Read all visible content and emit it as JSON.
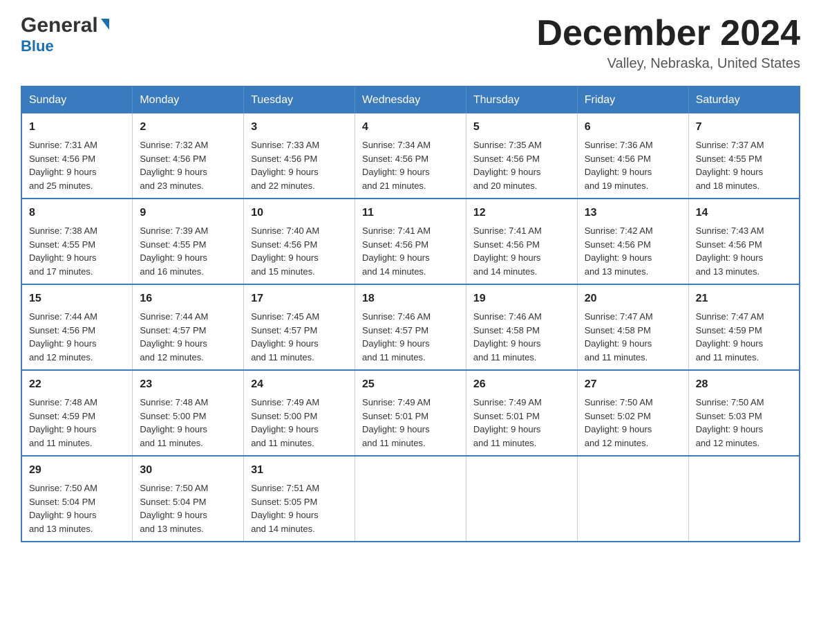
{
  "header": {
    "logo_general": "General",
    "logo_blue": "Blue",
    "month_title": "December 2024",
    "location": "Valley, Nebraska, United States"
  },
  "days_of_week": [
    "Sunday",
    "Monday",
    "Tuesday",
    "Wednesday",
    "Thursday",
    "Friday",
    "Saturday"
  ],
  "weeks": [
    [
      {
        "day": "1",
        "sunrise": "Sunrise: 7:31 AM",
        "sunset": "Sunset: 4:56 PM",
        "daylight": "Daylight: 9 hours",
        "daylight2": "and 25 minutes."
      },
      {
        "day": "2",
        "sunrise": "Sunrise: 7:32 AM",
        "sunset": "Sunset: 4:56 PM",
        "daylight": "Daylight: 9 hours",
        "daylight2": "and 23 minutes."
      },
      {
        "day": "3",
        "sunrise": "Sunrise: 7:33 AM",
        "sunset": "Sunset: 4:56 PM",
        "daylight": "Daylight: 9 hours",
        "daylight2": "and 22 minutes."
      },
      {
        "day": "4",
        "sunrise": "Sunrise: 7:34 AM",
        "sunset": "Sunset: 4:56 PM",
        "daylight": "Daylight: 9 hours",
        "daylight2": "and 21 minutes."
      },
      {
        "day": "5",
        "sunrise": "Sunrise: 7:35 AM",
        "sunset": "Sunset: 4:56 PM",
        "daylight": "Daylight: 9 hours",
        "daylight2": "and 20 minutes."
      },
      {
        "day": "6",
        "sunrise": "Sunrise: 7:36 AM",
        "sunset": "Sunset: 4:56 PM",
        "daylight": "Daylight: 9 hours",
        "daylight2": "and 19 minutes."
      },
      {
        "day": "7",
        "sunrise": "Sunrise: 7:37 AM",
        "sunset": "Sunset: 4:55 PM",
        "daylight": "Daylight: 9 hours",
        "daylight2": "and 18 minutes."
      }
    ],
    [
      {
        "day": "8",
        "sunrise": "Sunrise: 7:38 AM",
        "sunset": "Sunset: 4:55 PM",
        "daylight": "Daylight: 9 hours",
        "daylight2": "and 17 minutes."
      },
      {
        "day": "9",
        "sunrise": "Sunrise: 7:39 AM",
        "sunset": "Sunset: 4:55 PM",
        "daylight": "Daylight: 9 hours",
        "daylight2": "and 16 minutes."
      },
      {
        "day": "10",
        "sunrise": "Sunrise: 7:40 AM",
        "sunset": "Sunset: 4:56 PM",
        "daylight": "Daylight: 9 hours",
        "daylight2": "and 15 minutes."
      },
      {
        "day": "11",
        "sunrise": "Sunrise: 7:41 AM",
        "sunset": "Sunset: 4:56 PM",
        "daylight": "Daylight: 9 hours",
        "daylight2": "and 14 minutes."
      },
      {
        "day": "12",
        "sunrise": "Sunrise: 7:41 AM",
        "sunset": "Sunset: 4:56 PM",
        "daylight": "Daylight: 9 hours",
        "daylight2": "and 14 minutes."
      },
      {
        "day": "13",
        "sunrise": "Sunrise: 7:42 AM",
        "sunset": "Sunset: 4:56 PM",
        "daylight": "Daylight: 9 hours",
        "daylight2": "and 13 minutes."
      },
      {
        "day": "14",
        "sunrise": "Sunrise: 7:43 AM",
        "sunset": "Sunset: 4:56 PM",
        "daylight": "Daylight: 9 hours",
        "daylight2": "and 13 minutes."
      }
    ],
    [
      {
        "day": "15",
        "sunrise": "Sunrise: 7:44 AM",
        "sunset": "Sunset: 4:56 PM",
        "daylight": "Daylight: 9 hours",
        "daylight2": "and 12 minutes."
      },
      {
        "day": "16",
        "sunrise": "Sunrise: 7:44 AM",
        "sunset": "Sunset: 4:57 PM",
        "daylight": "Daylight: 9 hours",
        "daylight2": "and 12 minutes."
      },
      {
        "day": "17",
        "sunrise": "Sunrise: 7:45 AM",
        "sunset": "Sunset: 4:57 PM",
        "daylight": "Daylight: 9 hours",
        "daylight2": "and 11 minutes."
      },
      {
        "day": "18",
        "sunrise": "Sunrise: 7:46 AM",
        "sunset": "Sunset: 4:57 PM",
        "daylight": "Daylight: 9 hours",
        "daylight2": "and 11 minutes."
      },
      {
        "day": "19",
        "sunrise": "Sunrise: 7:46 AM",
        "sunset": "Sunset: 4:58 PM",
        "daylight": "Daylight: 9 hours",
        "daylight2": "and 11 minutes."
      },
      {
        "day": "20",
        "sunrise": "Sunrise: 7:47 AM",
        "sunset": "Sunset: 4:58 PM",
        "daylight": "Daylight: 9 hours",
        "daylight2": "and 11 minutes."
      },
      {
        "day": "21",
        "sunrise": "Sunrise: 7:47 AM",
        "sunset": "Sunset: 4:59 PM",
        "daylight": "Daylight: 9 hours",
        "daylight2": "and 11 minutes."
      }
    ],
    [
      {
        "day": "22",
        "sunrise": "Sunrise: 7:48 AM",
        "sunset": "Sunset: 4:59 PM",
        "daylight": "Daylight: 9 hours",
        "daylight2": "and 11 minutes."
      },
      {
        "day": "23",
        "sunrise": "Sunrise: 7:48 AM",
        "sunset": "Sunset: 5:00 PM",
        "daylight": "Daylight: 9 hours",
        "daylight2": "and 11 minutes."
      },
      {
        "day": "24",
        "sunrise": "Sunrise: 7:49 AM",
        "sunset": "Sunset: 5:00 PM",
        "daylight": "Daylight: 9 hours",
        "daylight2": "and 11 minutes."
      },
      {
        "day": "25",
        "sunrise": "Sunrise: 7:49 AM",
        "sunset": "Sunset: 5:01 PM",
        "daylight": "Daylight: 9 hours",
        "daylight2": "and 11 minutes."
      },
      {
        "day": "26",
        "sunrise": "Sunrise: 7:49 AM",
        "sunset": "Sunset: 5:01 PM",
        "daylight": "Daylight: 9 hours",
        "daylight2": "and 11 minutes."
      },
      {
        "day": "27",
        "sunrise": "Sunrise: 7:50 AM",
        "sunset": "Sunset: 5:02 PM",
        "daylight": "Daylight: 9 hours",
        "daylight2": "and 12 minutes."
      },
      {
        "day": "28",
        "sunrise": "Sunrise: 7:50 AM",
        "sunset": "Sunset: 5:03 PM",
        "daylight": "Daylight: 9 hours",
        "daylight2": "and 12 minutes."
      }
    ],
    [
      {
        "day": "29",
        "sunrise": "Sunrise: 7:50 AM",
        "sunset": "Sunset: 5:04 PM",
        "daylight": "Daylight: 9 hours",
        "daylight2": "and 13 minutes."
      },
      {
        "day": "30",
        "sunrise": "Sunrise: 7:50 AM",
        "sunset": "Sunset: 5:04 PM",
        "daylight": "Daylight: 9 hours",
        "daylight2": "and 13 minutes."
      },
      {
        "day": "31",
        "sunrise": "Sunrise: 7:51 AM",
        "sunset": "Sunset: 5:05 PM",
        "daylight": "Daylight: 9 hours",
        "daylight2": "and 14 minutes."
      },
      null,
      null,
      null,
      null
    ]
  ]
}
